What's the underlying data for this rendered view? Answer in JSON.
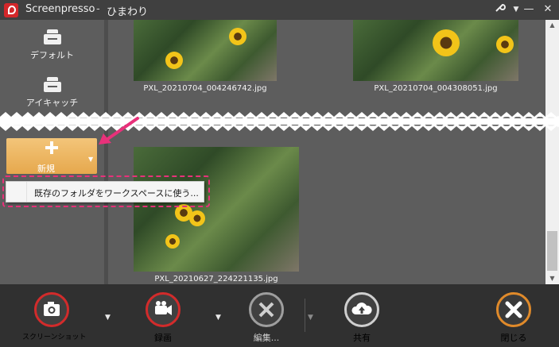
{
  "titlebar": {
    "app_name": "Screenpresso",
    "separator": "-",
    "document": "ひまわり"
  },
  "sidebar": {
    "items": [
      {
        "label": "デフォルト",
        "icon": "printer-stack-icon"
      },
      {
        "label": "アイキャッチ",
        "icon": "printer-stack-icon"
      }
    ],
    "new_button_label": "新規"
  },
  "dropdown": {
    "item_label": "既存のフォルダをワークスペースに使う..."
  },
  "content": {
    "photos": [
      {
        "filename": "PXL_20210704_004246742.jpg"
      },
      {
        "filename": "PXL_20210704_004308051.jpg"
      },
      {
        "filename": "PXL_20210627_224221135.jpg"
      }
    ]
  },
  "toolbar": {
    "screenshot_label": "スクリーンショット",
    "record_label": "録画",
    "edit_label": "編集...",
    "share_label": "共有",
    "close_label": "閉じる"
  },
  "colors": {
    "accent_red": "#d22b2b",
    "new_button": "#e6a84d",
    "annotation_pink": "#e8317a",
    "close_orange": "#e08a2a"
  }
}
